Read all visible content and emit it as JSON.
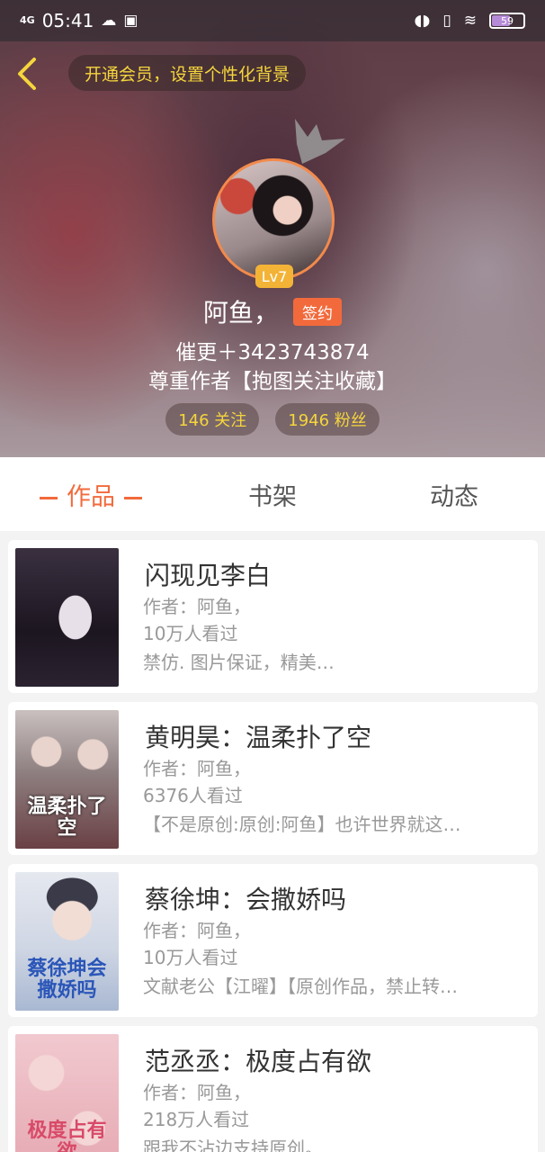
{
  "status_bar": {
    "network": "4G",
    "time": "05:41",
    "battery": "59",
    "battery_level": 0.59
  },
  "header": {
    "vip_prompt": "开通会员，设置个性化背景",
    "level": "Lv7",
    "name": "阿鱼，",
    "sign_badge": "签约",
    "bio_line1": "催更＋3423743874",
    "bio_line2": "尊重作者【抱图关注收藏】",
    "following": "146 关注",
    "followers": "1946 粉丝"
  },
  "tabs": [
    {
      "label": "作品",
      "active": true
    },
    {
      "label": "书架",
      "active": false
    },
    {
      "label": "动态",
      "active": false
    }
  ],
  "works": [
    {
      "title": "闪现见李白",
      "author": "作者：阿鱼，",
      "views": "10万人看过",
      "desc": "禁仿. 图片保证，精美…",
      "cover_text": ""
    },
    {
      "title": "黄明昊：温柔扑了空",
      "author": "作者：阿鱼，",
      "views": "6376人看过",
      "desc": "【不是原创:原创:阿鱼】也许世界就这…",
      "cover_text": "温柔扑了空"
    },
    {
      "title": "蔡徐坤：会撒娇吗",
      "author": "作者：阿鱼，",
      "views": "10万人看过",
      "desc": "文献老公【江曜】【原创作品，禁止转…",
      "cover_text": "蔡徐坤会撒娇吗"
    },
    {
      "title": "范丞丞：极度占有欲",
      "author": "作者：阿鱼，",
      "views": "218万人看过",
      "desc": "跟我不沾边支持原创。",
      "cover_text": "极度占有欲"
    }
  ],
  "colors": {
    "accent": "#f26a3c",
    "gold": "#f5d53c",
    "avatar_ring": "#f28a4c"
  }
}
